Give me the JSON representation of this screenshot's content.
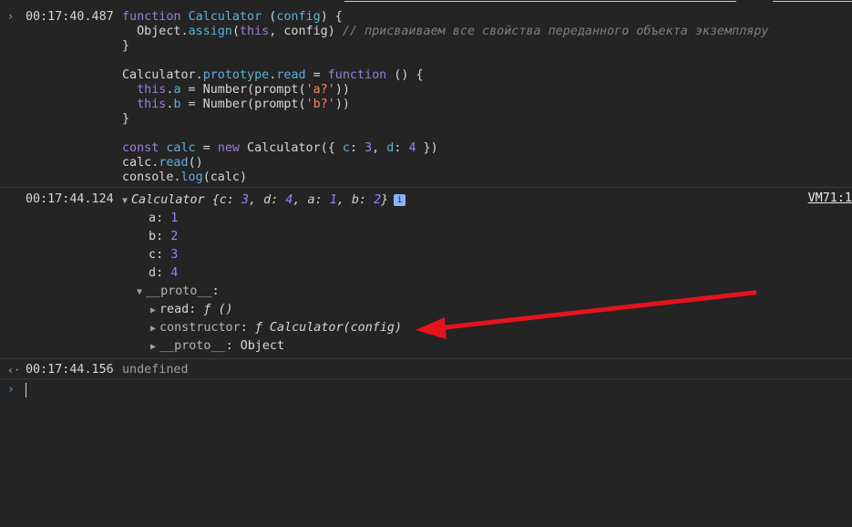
{
  "entries": {
    "input1": {
      "timestamp": "00:17:40.487",
      "code": {
        "l1": {
          "a": "function ",
          "b": "Calculator",
          "c": " (",
          "d": "config",
          "e": ") {"
        },
        "l2": {
          "a": "  Object.",
          "b": "assign",
          "c": "(",
          "d": "this",
          "e": ", config) ",
          "f": "// присваиваем все свойства переданного объекта экземпляру"
        },
        "l3": "}",
        "l5": {
          "a": "Calculator.",
          "b": "prototype",
          "c": ".",
          "d": "read",
          "e": " = ",
          "f": "function",
          "g": " () {"
        },
        "l6": {
          "a": "  ",
          "b": "this",
          "c": ".",
          "d": "a",
          "e": " = Number(prompt(",
          "f": "'a?'",
          "g": "))"
        },
        "l7": {
          "a": "  ",
          "b": "this",
          "c": ".",
          "d": "b",
          "e": " = Number(prompt(",
          "f": "'b?'",
          "g": "))"
        },
        "l8": "}",
        "l10": {
          "a": "const ",
          "b": "calc",
          "c": " = ",
          "d": "new",
          "e": " Calculator({ ",
          "f": "c",
          "g": ": ",
          "h": "3",
          "i": ", ",
          "j": "d",
          "k": ": ",
          "l": "4",
          "m": " })"
        },
        "l11": {
          "a": "calc.",
          "b": "read",
          "c": "()"
        },
        "l12": {
          "a": "console.",
          "b": "log",
          "c": "(calc)"
        }
      }
    },
    "output1": {
      "timestamp": "00:17:44.124",
      "source_link": "VM71:1",
      "summary": {
        "name": "Calculator ",
        "open": "{",
        "k1": "c",
        "v1": "3",
        "k2": "d",
        "v2": "4",
        "k3": "a",
        "v3": "1",
        "k4": "b",
        "v4": "2",
        "close": "}"
      },
      "info_badge": "i",
      "props": [
        {
          "key": "a",
          "value": "1"
        },
        {
          "key": "b",
          "value": "2"
        },
        {
          "key": "c",
          "value": "3"
        },
        {
          "key": "d",
          "value": "4"
        }
      ],
      "proto_label": "__proto__",
      "proto_colon": ":",
      "proto_items": {
        "read_key": "read",
        "read_val": "ƒ ()",
        "ctor_key": "constructor",
        "ctor_val": "ƒ Calculator(config)",
        "inner_proto_key": "__proto__",
        "inner_proto_val": "Object"
      }
    },
    "return1": {
      "timestamp": "00:17:44.156",
      "value": "undefined"
    }
  },
  "colors": {
    "background": "#242424",
    "keyword": "#9a7fd8",
    "identifier": "#5db0d7",
    "string": "#f28b54",
    "number": "#9980ff",
    "comment": "#7f7f7f",
    "annotation_arrow": "#e3141b"
  },
  "icons": {
    "input_marker": "chevron-right-icon",
    "return_marker": "return-arrow-icon",
    "prompt_marker": "prompt-chevron-icon",
    "expand": "triangle-right-icon",
    "collapse": "triangle-down-icon",
    "annotation": "red-arrow-annotation"
  }
}
